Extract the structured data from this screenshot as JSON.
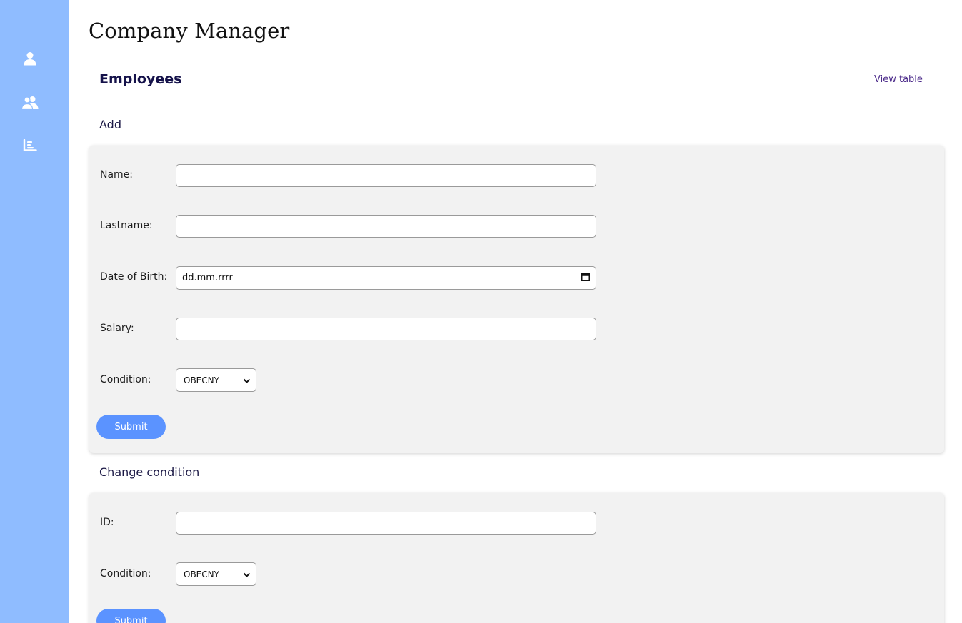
{
  "app": {
    "title": "Company Manager"
  },
  "sidebar": {
    "items": [
      {
        "icon": "user-icon"
      },
      {
        "icon": "users-icon"
      },
      {
        "icon": "chart-bar-icon"
      }
    ]
  },
  "section": {
    "title": "Employees",
    "view_link": "View table"
  },
  "add_form": {
    "title": "Add",
    "name_label": "Name:",
    "name_value": "",
    "lastname_label": "Lastname:",
    "lastname_value": "",
    "dob_label": "Date of Birth:",
    "dob_placeholder": "dd.mm.rrrr",
    "salary_label": "Salary:",
    "salary_value": "",
    "condition_label": "Condition:",
    "condition_value": "OBECNY",
    "submit_label": "Submit"
  },
  "change_form": {
    "title": "Change condition",
    "id_label": "ID:",
    "id_value": "",
    "condition_label": "Condition:",
    "condition_value": "OBECNY",
    "submit_label": "Submit"
  },
  "colors": {
    "sidebar": "#8fbcff",
    "accent": "#5b93ff",
    "heading": "#15124a"
  }
}
